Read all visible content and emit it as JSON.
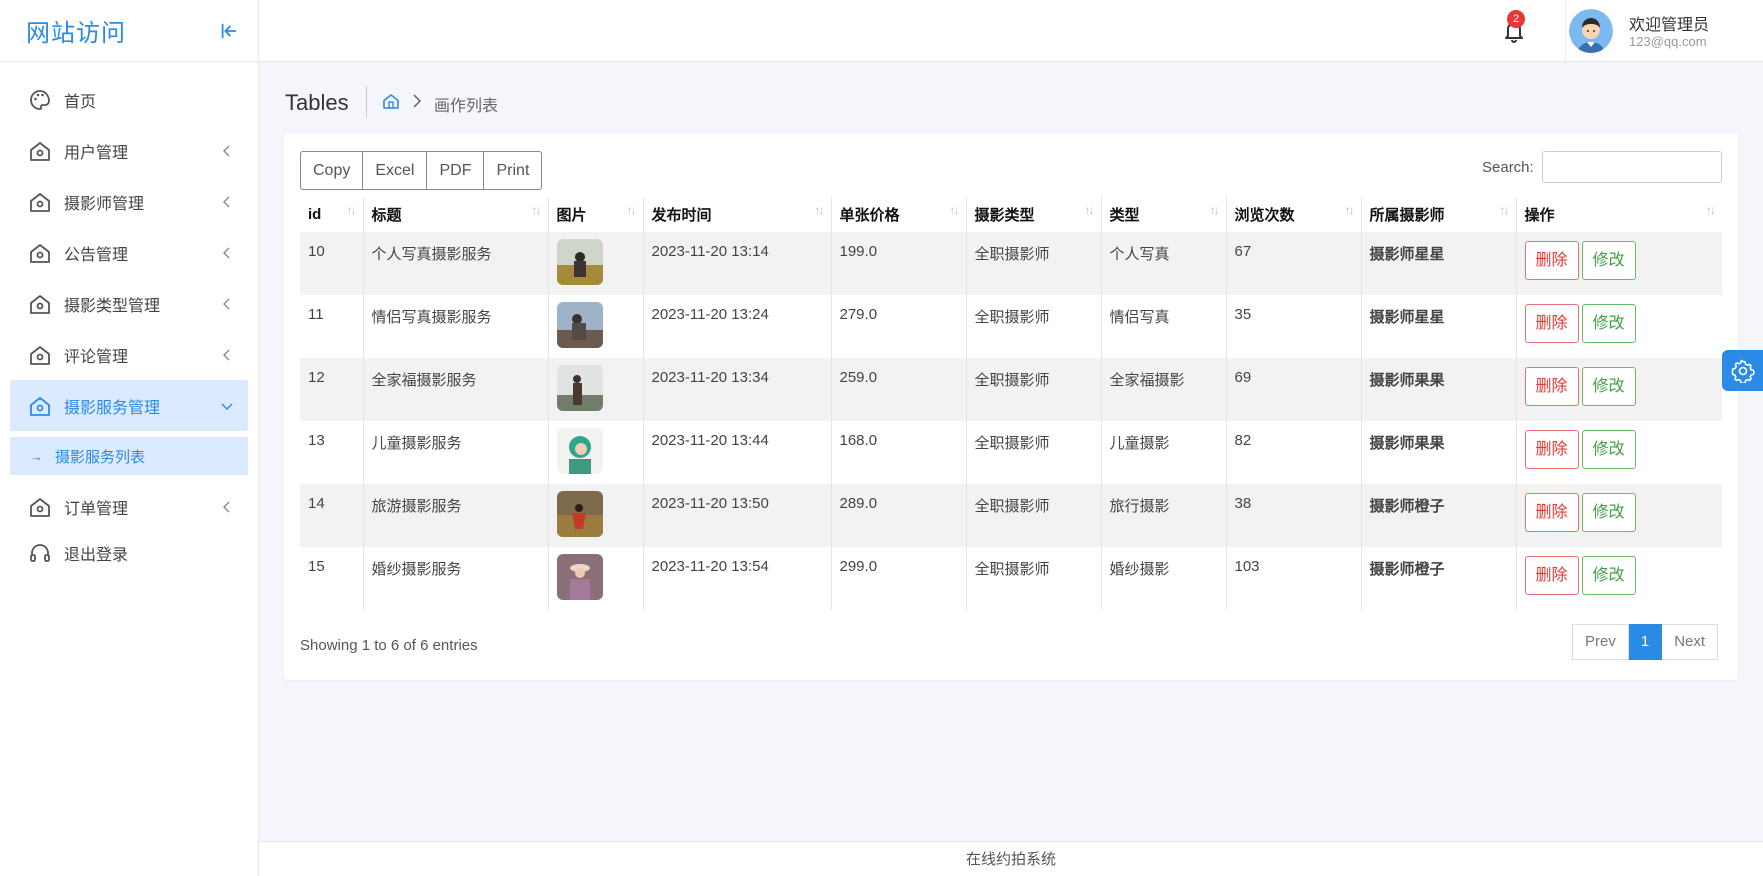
{
  "brand": {
    "title": "网站访问"
  },
  "sidebar": {
    "items": [
      {
        "label": "首页",
        "icon": "palette-icon"
      },
      {
        "label": "用户管理",
        "icon": "home-icon"
      },
      {
        "label": "摄影师管理",
        "icon": "home-icon"
      },
      {
        "label": "公告管理",
        "icon": "home-icon"
      },
      {
        "label": "摄影类型管理",
        "icon": "home-icon"
      },
      {
        "label": "评论管理",
        "icon": "home-icon"
      },
      {
        "label": "摄影服务管理",
        "icon": "home-icon",
        "active": true
      },
      {
        "label": "订单管理",
        "icon": "home-icon"
      },
      {
        "label": "退出登录",
        "icon": "headset-icon"
      }
    ],
    "submenu": {
      "label": "摄影服务列表"
    }
  },
  "header": {
    "notification_count": "2",
    "welcome": "欢迎管理员",
    "email": "123@qq.com"
  },
  "breadcrumb": {
    "title": "Tables",
    "current": "画作列表"
  },
  "toolbar": {
    "copy": "Copy",
    "excel": "Excel",
    "pdf": "PDF",
    "print": "Print",
    "search_label": "Search:"
  },
  "table": {
    "columns": [
      "id",
      "标题",
      "图片",
      "发布时间",
      "单张价格",
      "摄影类型",
      "类型",
      "浏览次数",
      "所属摄影师",
      "操作"
    ],
    "delete_label": "删除",
    "edit_label": "修改",
    "rows": [
      {
        "id": "10",
        "title": "个人写真摄影服务",
        "time": "2023-11-20 13:14",
        "price": "199.0",
        "ptype": "全职摄影师",
        "type": "个人写真",
        "views": "67",
        "photographer": "摄影师星星"
      },
      {
        "id": "11",
        "title": "情侣写真摄影服务",
        "time": "2023-11-20 13:24",
        "price": "279.0",
        "ptype": "全职摄影师",
        "type": "情侣写真",
        "views": "35",
        "photographer": "摄影师星星"
      },
      {
        "id": "12",
        "title": "全家福摄影服务",
        "time": "2023-11-20 13:34",
        "price": "259.0",
        "ptype": "全职摄影师",
        "type": "全家福摄影",
        "views": "69",
        "photographer": "摄影师果果"
      },
      {
        "id": "13",
        "title": "儿童摄影服务",
        "time": "2023-11-20 13:44",
        "price": "168.0",
        "ptype": "全职摄影师",
        "type": "儿童摄影",
        "views": "82",
        "photographer": "摄影师果果"
      },
      {
        "id": "14",
        "title": "旅游摄影服务",
        "time": "2023-11-20 13:50",
        "price": "289.0",
        "ptype": "全职摄影师",
        "type": "旅行摄影",
        "views": "38",
        "photographer": "摄影师橙子"
      },
      {
        "id": "15",
        "title": "婚纱摄影服务",
        "time": "2023-11-20 13:54",
        "price": "299.0",
        "ptype": "全职摄影师",
        "type": "婚纱摄影",
        "views": "103",
        "photographer": "摄影师橙子"
      }
    ]
  },
  "pagination": {
    "info": "Showing 1 to 6 of 6 entries",
    "prev": "Prev",
    "current": "1",
    "next": "Next"
  },
  "footer": {
    "text": "在线约拍系统"
  },
  "colors": {
    "accent": "#2a8be6",
    "danger": "#e53935",
    "success": "#43a047"
  }
}
